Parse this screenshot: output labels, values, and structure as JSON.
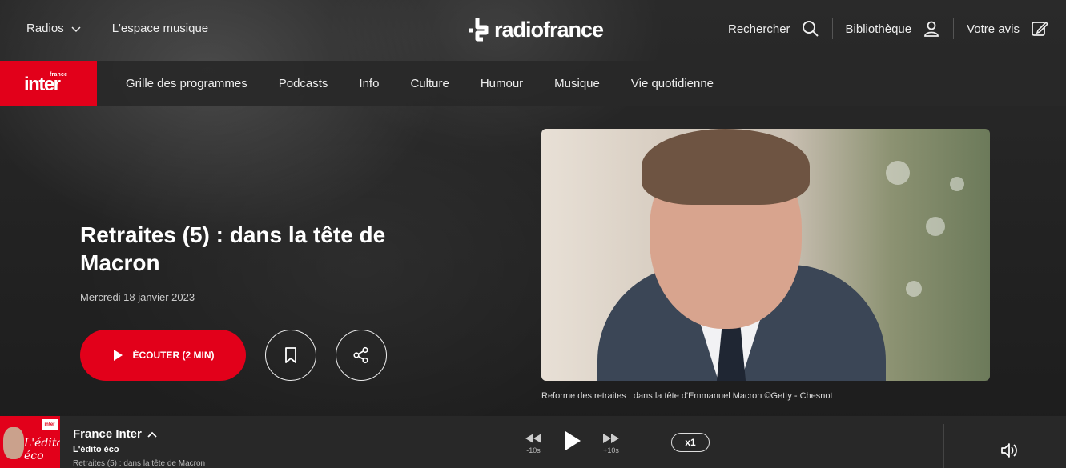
{
  "topbar": {
    "radios_label": "Radios",
    "espace_label": "L'espace musique",
    "logo_text": "radiofrance",
    "search_label": "Rechercher",
    "library_label": "Bibliothèque",
    "feedback_label": "Votre avis"
  },
  "brand": {
    "small": "france",
    "big": "inter",
    "color": "#e2001a"
  },
  "nav": [
    "Grille des programmes",
    "Podcasts",
    "Info",
    "Culture",
    "Humour",
    "Musique",
    "Vie quotidienne"
  ],
  "episode": {
    "title": "Retraites (5) : dans la tête de Macron",
    "date": "Mercredi 18 janvier 2023",
    "listen_label": "ÉCOUTER (2 MIN)",
    "caption": "Reforme des retraites : dans la tête d'Emmanuel Macron ©Getty - Chesnot"
  },
  "player": {
    "thumb_title": "L'édito éco",
    "thumb_tag": "inter",
    "station": "France Inter",
    "show": "L'édito éco",
    "episode": "Retraites (5) : dans la tête de Macron",
    "rewind_label": "-10s",
    "forward_label": "+10s",
    "speed": "x1"
  }
}
